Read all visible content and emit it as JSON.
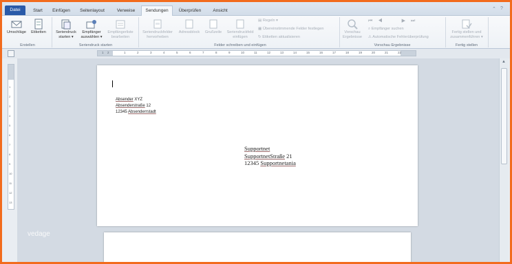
{
  "tabs": [
    {
      "label": "Datei"
    },
    {
      "label": "Start"
    },
    {
      "label": "Einfügen"
    },
    {
      "label": "Seitenlayout"
    },
    {
      "label": "Verweise"
    },
    {
      "label": "Sendungen"
    },
    {
      "label": "Überprüfen"
    },
    {
      "label": "Ansicht"
    }
  ],
  "ribbon": {
    "create": {
      "envelopes": "Umschläge",
      "labels": "Etiketten",
      "group": "Erstellen"
    },
    "start_merge": {
      "start_l1": "Seriendruck",
      "start_l2": "starten ▾",
      "select_l1": "Empfänger",
      "select_l2": "auswählen ▾",
      "edit_l1": "Empfängerliste",
      "edit_l2": "bearbeiten",
      "group": "Seriendruck starten"
    },
    "write_insert": {
      "highlight_l1": "Seriendruckfelder",
      "highlight_l2": "hervorheben",
      "address_block": "Adressblock",
      "greeting": "Grußzeile",
      "insert_l1": "Seriendruckfeld",
      "insert_l2": "einfügen",
      "rules": "Regeln ▾",
      "match_fields": "Übereinstimmende Felder festlegen",
      "update_labels": "Etiketten aktualisieren",
      "group": "Felder schreiben und einfügen"
    },
    "preview": {
      "preview_l1": "Vorschau",
      "preview_l2": "Ergebnisse",
      "find_recipient": "Empfänger suchen",
      "auto_check": "Automatische Fehlerüberprüfung",
      "group": "Vorschau Ergebnisse"
    },
    "finish": {
      "finish_l1": "Fertig stellen und",
      "finish_l2": "zusammenführen ▾",
      "group": "Fertig stellen"
    }
  },
  "ruler": {
    "h_ticks": [
      "1",
      "2",
      "1",
      "2",
      "3",
      "4",
      "5",
      "6",
      "7",
      "8",
      "9",
      "10",
      "11",
      "12",
      "13",
      "14",
      "15",
      "16",
      "17",
      "18",
      "19",
      "20",
      "21",
      "22"
    ],
    "v_ticks": [
      "1",
      "2",
      "3",
      "4",
      "5",
      "6",
      "7",
      "8",
      "9",
      "10",
      "11",
      "12",
      "13"
    ]
  },
  "document": {
    "sender": {
      "line1_word": "Absender",
      "line1_rest": " XYZ",
      "line2_word": "Absenderstraße",
      "line2_rest": " 12",
      "line3_pre": "12345 ",
      "line3_word": "Absenderrstadt"
    },
    "recipient": {
      "line1": "Supportnet",
      "line2_word": "SupportnetStraße",
      "line2_rest": " 21",
      "line3_pre": "12345 ",
      "line3_word": "Supportnetania"
    }
  },
  "watermark": "vedage",
  "colors": {
    "frame": "#f26b1d",
    "file_tab": "#2a5aa8",
    "ribbon_bg": "#f8f9fb",
    "doc_area": "#d3dae3"
  }
}
